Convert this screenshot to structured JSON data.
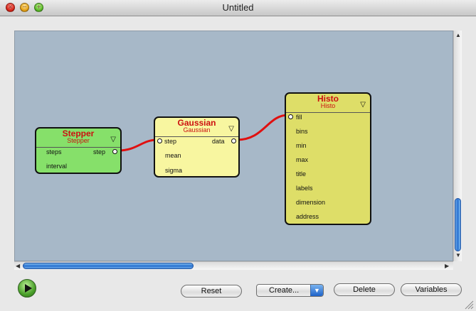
{
  "window": {
    "title": "Untitled"
  },
  "nodes": {
    "stepper": {
      "name": "Stepper",
      "type": "Stepper",
      "inputs": [
        "steps",
        "interval"
      ],
      "output": "step"
    },
    "gaussian": {
      "name": "Gaussian",
      "type": "Gaussian",
      "inputs": [
        "step",
        "mean",
        "sigma"
      ],
      "output": "data"
    },
    "histo": {
      "name": "Histo",
      "type": "Histo",
      "inputs": [
        "fill",
        "bins",
        "min",
        "max",
        "title",
        "labels",
        "dimension",
        "address"
      ]
    }
  },
  "colors": {
    "stepper": "#86e06a",
    "gaussian": "#f8f6a0",
    "histo": "#dede68",
    "wire": "#e01010",
    "canvas": "#a7b8c8"
  },
  "icons": {
    "play": "play-icon",
    "dropdown": "chevron-down-icon",
    "node_menu": "triangle-down-icon"
  },
  "toolbar": {
    "reset_label": "Reset",
    "create_label": "Create...",
    "delete_label": "Delete",
    "variables_label": "Variables"
  }
}
